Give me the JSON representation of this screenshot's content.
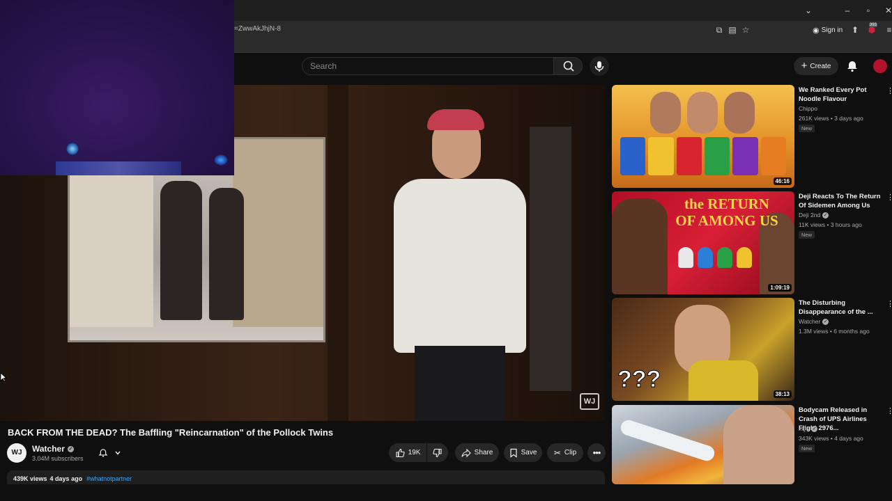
{
  "browser": {
    "url_fragment": "=ZwwAkJhjN-8",
    "sign_in_label": "Sign in",
    "extension_badge": "393",
    "window_controls": [
      "chevron-down-icon",
      "minimize-icon",
      "restore-icon",
      "close-icon"
    ]
  },
  "header": {
    "search_placeholder": "Search",
    "create_label": "Create"
  },
  "video": {
    "title": "BACK FROM THE DEAD? The Baffling \"Reincarnation\" of the Pollock Twins",
    "watermark": "WJ",
    "channel": {
      "name": "Watcher",
      "avatar_text": "WJ",
      "subscribers": "3.04M subscribers"
    },
    "actions": {
      "likes": "19K",
      "share_label": "Share",
      "save_label": "Save",
      "clip_label": "Clip"
    },
    "description": {
      "views": "439K views",
      "age": "4 days ago",
      "hashtag": "#whatnotpartner"
    }
  },
  "recommendations": [
    {
      "title": "We Ranked Every Pot Noodle Flavour",
      "channel": "Chippo",
      "verified": false,
      "views": "261K views",
      "age": "3 days ago",
      "badge": "New",
      "duration": "46:16",
      "thumb_color": "#e9a23b"
    },
    {
      "title": "Deji Reacts To The Return Of Sidemen Among Us",
      "channel": "Deji 2nd",
      "verified": true,
      "views": "11K views",
      "age": "3 hours ago",
      "badge": "New",
      "duration": "1:09:19",
      "thumb_color": "#c4122f",
      "thumb_text": "the RETURN OF AMONG US"
    },
    {
      "title": "The Disturbing Disappearance of the ...",
      "channel": "Watcher",
      "verified": true,
      "views": "1.3M views",
      "age": "6 months ago",
      "badge": "",
      "duration": "38:13",
      "thumb_color": "#c9a22a",
      "thumb_text": "???"
    },
    {
      "title": "Bodycam Released in Crash of UPS Airlines Flight 2976...",
      "channel": "xQc",
      "verified": true,
      "views": "343K views",
      "age": "4 days ago",
      "badge": "New",
      "duration": "",
      "thumb_color": "#d45a1c"
    }
  ],
  "colors": {
    "background": "#0f0f0f",
    "accent_red": "#ff0033",
    "link_blue": "#3ea6ff"
  }
}
